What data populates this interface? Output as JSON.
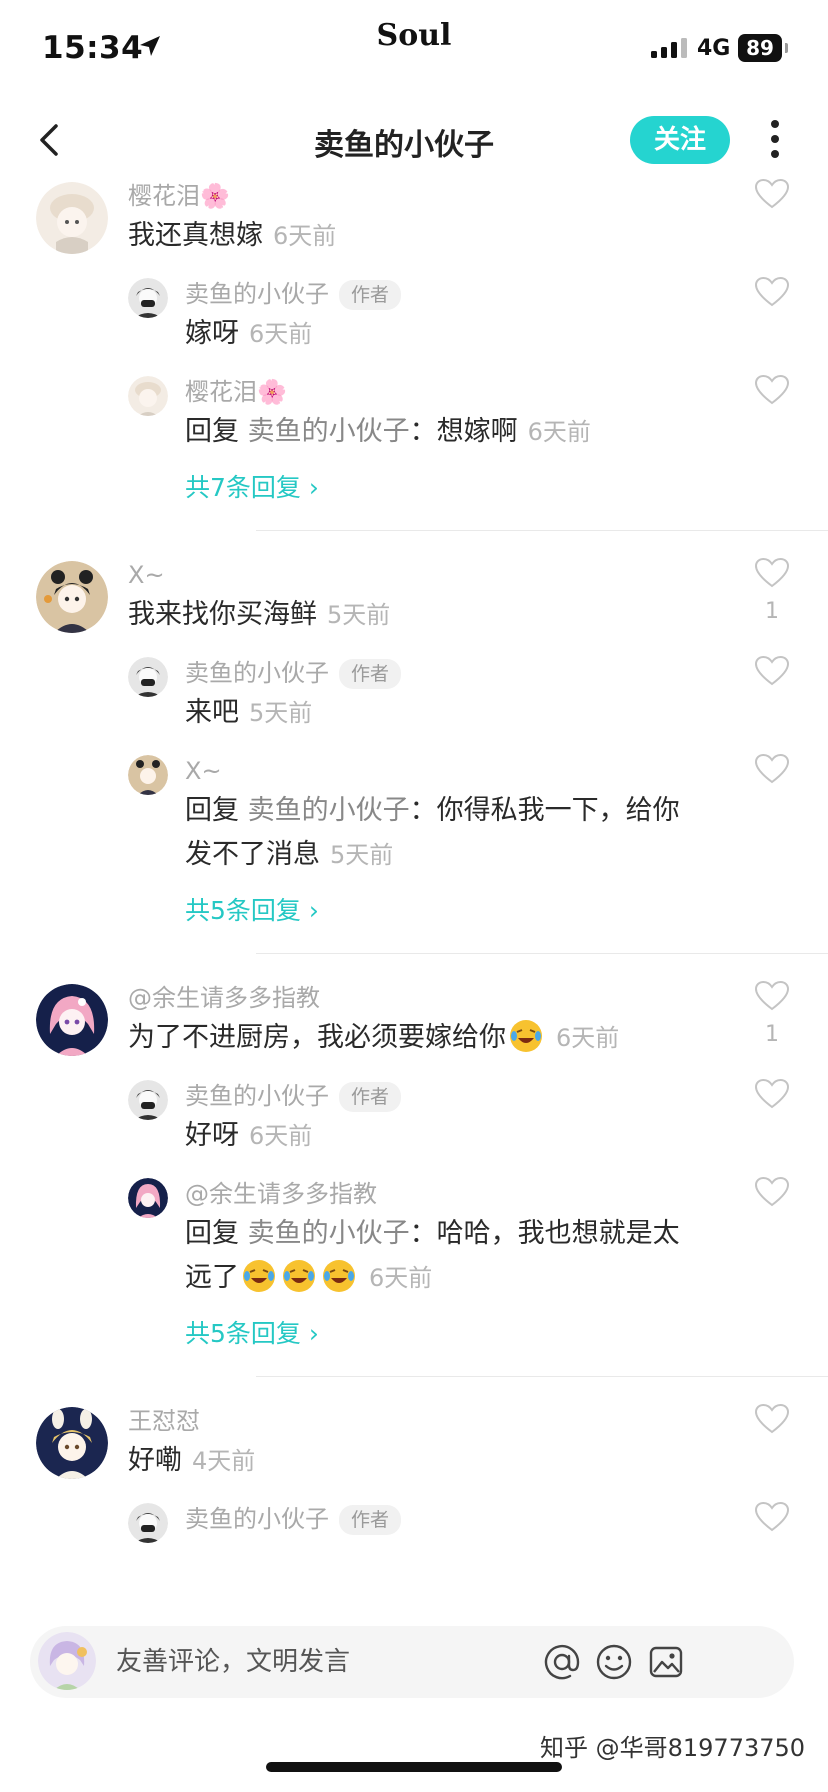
{
  "status_bar": {
    "time": "15:34",
    "brand": "Soul",
    "network": "4G",
    "battery": "89",
    "location_icon": "location-arrow-icon",
    "signal_icon": "cellular-signal-icon"
  },
  "nav": {
    "title": "卖鱼的小伙子",
    "follow_label": "关注",
    "back_icon": "chevron-left-icon",
    "more_icon": "more-vertical-icon",
    "accent_color": "#25d4d0"
  },
  "threads": [
    {
      "user": "樱花泪🌸",
      "text": "我还真想嫁",
      "time": "6天前",
      "likes": "",
      "replies": [
        {
          "user": "卖鱼的小伙子",
          "tag": "作者",
          "text": "嫁呀",
          "time": "6天前"
        },
        {
          "user": "樱花泪🌸",
          "reply_prefix": "回复",
          "reply_to": "卖鱼的小伙子",
          "text": "：想嫁啊",
          "time": "6天前"
        }
      ],
      "more": "共7条回复 ›"
    },
    {
      "user": "X~",
      "text": "我来找你买海鲜",
      "time": "5天前",
      "likes": "1",
      "replies": [
        {
          "user": "卖鱼的小伙子",
          "tag": "作者",
          "text": "来吧",
          "time": "5天前"
        },
        {
          "user": "X~",
          "reply_prefix": "回复",
          "reply_to": "卖鱼的小伙子",
          "text": "：你得私我一下，给你发不了消息",
          "time": "5天前"
        }
      ],
      "more": "共5条回复 ›"
    },
    {
      "user": "@余生请多多指教",
      "text": "为了不进厨房，我必须要嫁给你",
      "time": "6天前",
      "likes": "1",
      "replies": [
        {
          "user": "卖鱼的小伙子",
          "tag": "作者",
          "text": "好呀",
          "time": "6天前"
        },
        {
          "user": "@余生请多多指教",
          "reply_prefix": "回复",
          "reply_to": "卖鱼的小伙子",
          "text": "：哈哈，我也想就是太远了",
          "time": "6天前"
        }
      ],
      "more": "共5条回复 ›"
    },
    {
      "user": "王怼怼",
      "text": "好嘞",
      "time": "4天前",
      "likes": "",
      "replies": [
        {
          "user": "卖鱼的小伙子",
          "tag": "作者"
        }
      ]
    }
  ],
  "input_bar": {
    "placeholder": "友善评论，文明发言",
    "icons": [
      "at-icon",
      "emoji-icon",
      "image-icon"
    ]
  },
  "watermark": "知乎 @华哥819773750"
}
